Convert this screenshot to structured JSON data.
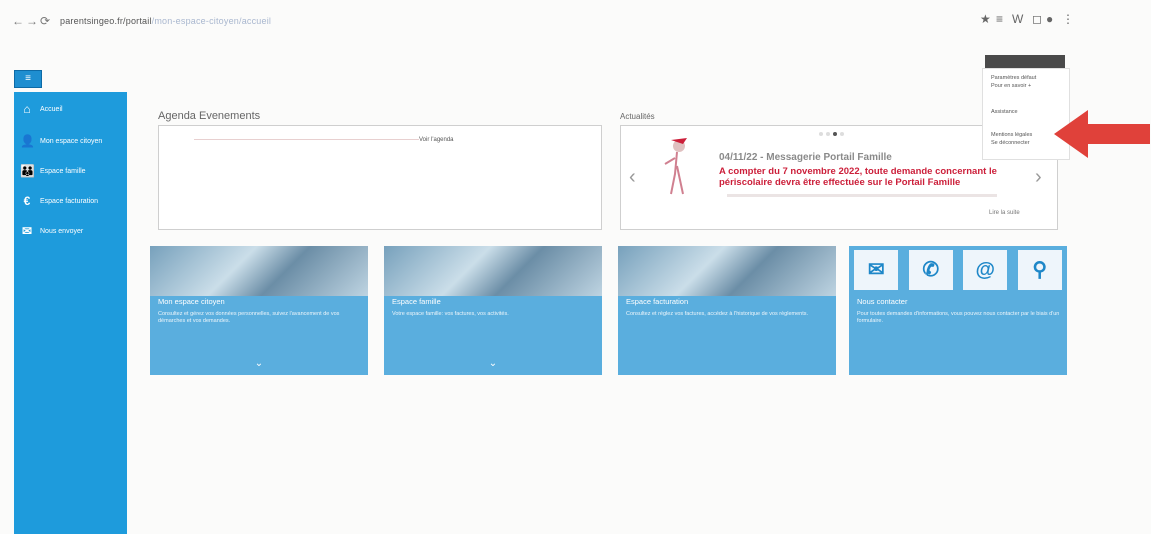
{
  "browser": {
    "back": "←",
    "forward": "→",
    "reload": "⟳",
    "url_host": "parentsingeo.fr/portail",
    "url_path": "/mon-espace-citoyen/accueil",
    "ext_icons": [
      "★",
      "≡",
      "W",
      "◻",
      "●",
      "⋮"
    ]
  },
  "sidebar": {
    "menu_icon": "≡",
    "items": [
      {
        "label": "Accueil",
        "icon": "home-icon",
        "glyph": "⌂"
      },
      {
        "label": "Mon espace citoyen",
        "icon": "user-icon",
        "glyph": "👤"
      },
      {
        "label": "Espace famille",
        "icon": "family-icon",
        "glyph": "👪"
      },
      {
        "label": "Espace facturation",
        "icon": "euro-icon",
        "glyph": "€"
      },
      {
        "label": "Nous envoyer",
        "icon": "mail-icon",
        "glyph": "✉"
      }
    ]
  },
  "agenda": {
    "title": "Agenda Evenements",
    "link": "Voir l'agenda"
  },
  "actualites": {
    "title": "Actualités",
    "news_title": "04/11/22 - Messagerie Portail Famille",
    "news_body": "A compter du 7 novembre 2022, toute demande concernant le périscolaire devra être effectuée sur le Portail Famille",
    "more": "Lire la suite"
  },
  "cards": [
    {
      "title": "Mon espace citoyen",
      "desc": "Consultez et gérez vos données personnelles, suivez l'avancement de vos démarches et vos demandes.",
      "chev": "⌄"
    },
    {
      "title": "Espace famille",
      "desc": "Votre espace famille: vos factures, vos activités.",
      "chev": "⌄"
    },
    {
      "title": "Espace facturation",
      "desc": "Consultez et réglez vos factures, accédez à l'historique de vos règlements.",
      "chev": ""
    },
    {
      "title": "Nous contacter",
      "desc": "Pour toutes demandes d'informations, vous pouvez nous contacter par le biais d'un formulaire.",
      "chev": ""
    }
  ],
  "contact_icons": [
    "✉",
    "✆",
    "@",
    "⚲"
  ],
  "dropdown": {
    "items": [
      "Paramètres défaut",
      "Pour en savoir +",
      "Assistance",
      "Mentions légales",
      "Se déconnecter"
    ]
  },
  "colors": {
    "sidebar": "#1e9bdc",
    "card": "#5aaede",
    "alert": "#cc1f3a",
    "arrow": "#e0413a"
  }
}
